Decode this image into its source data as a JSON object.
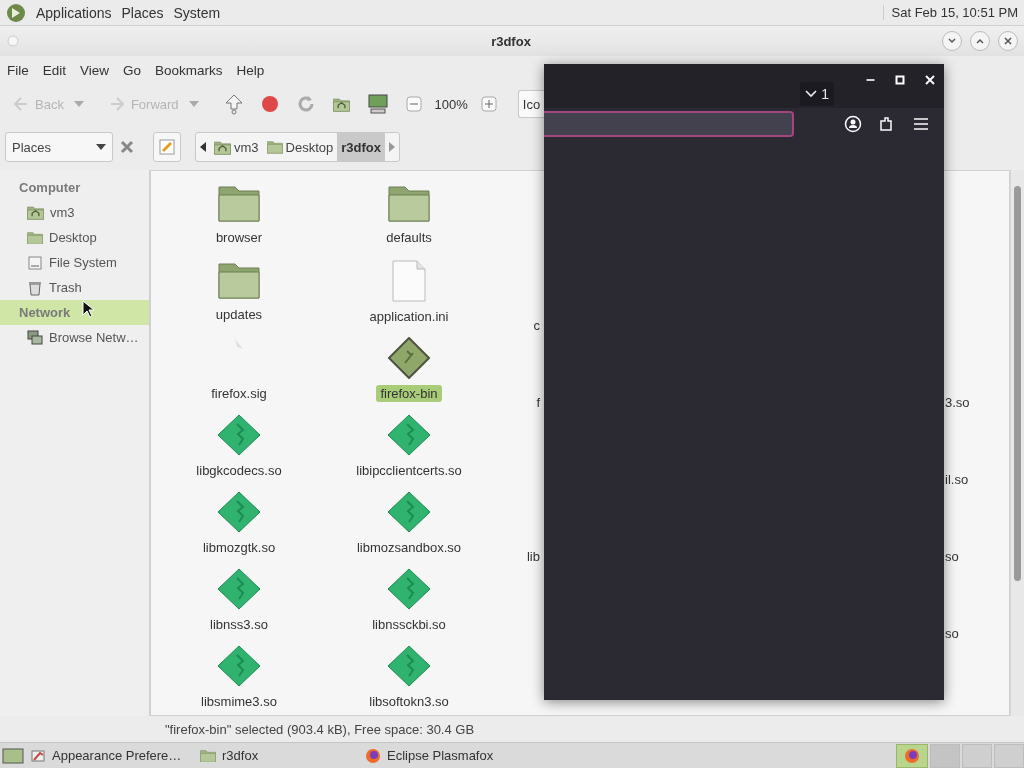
{
  "top_panel": {
    "menus": [
      "Applications",
      "Places",
      "System"
    ],
    "clock": "Sat Feb 15, 10:51 PM"
  },
  "file_manager": {
    "title": "r3dfox",
    "menu": [
      "File",
      "Edit",
      "View",
      "Go",
      "Bookmarks",
      "Help"
    ],
    "toolbar": {
      "back": {
        "label": "Back",
        "disabled": true
      },
      "forward": {
        "label": "Forward",
        "disabled": true
      },
      "zoom": "100%",
      "view_select": "Ico"
    },
    "location": {
      "places_select": "Places",
      "breadcrumb": [
        {
          "label": "vm3",
          "selected": false
        },
        {
          "label": "Desktop",
          "selected": false
        },
        {
          "label": "r3dfox",
          "selected": true
        }
      ]
    },
    "sidebar": [
      {
        "heading": "Computer",
        "highlighted": false,
        "items": [
          "vm3",
          "Desktop",
          "File System",
          "Trash"
        ]
      },
      {
        "heading": "Network",
        "highlighted": true,
        "items": [
          "Browse Netw…"
        ]
      }
    ],
    "rows": [
      [
        {
          "kind": "folder",
          "name": "browser",
          "selected": false
        },
        {
          "kind": "folder",
          "name": "defaults",
          "selected": false
        },
        {
          "kind": "hidden"
        },
        {
          "kind": "hidden"
        },
        {
          "kind": "hidden"
        }
      ],
      [
        {
          "kind": "folder",
          "name": "updates",
          "selected": false
        },
        {
          "kind": "document",
          "name": "application.ini",
          "selected": false
        },
        {
          "kind": "clipped_left",
          "name": "c"
        },
        {
          "kind": "hidden"
        },
        {
          "kind": "hidden"
        }
      ],
      [
        {
          "kind": "sig",
          "name": "firefox.sig",
          "selected": false
        },
        {
          "kind": "executable",
          "name": "firefox-bin",
          "selected": true
        },
        {
          "kind": "clipped_left",
          "name": "f"
        },
        {
          "kind": "hidden"
        },
        {
          "kind": "clipped_right",
          "name": "3.so"
        }
      ],
      [
        {
          "kind": "library",
          "name": "libgkcodecs.so",
          "selected": false
        },
        {
          "kind": "library",
          "name": "libipcclientcerts.so",
          "selected": false
        },
        {
          "kind": "hidden"
        },
        {
          "kind": "hidden"
        },
        {
          "kind": "clipped_right",
          "name": "il.so"
        }
      ],
      [
        {
          "kind": "library",
          "name": "libmozgtk.so",
          "selected": false
        },
        {
          "kind": "library",
          "name": "libmozsandbox.so",
          "selected": false
        },
        {
          "kind": "clipped_left",
          "name": "lib"
        },
        {
          "kind": "hidden"
        },
        {
          "kind": "clipped_right",
          "name": "so"
        }
      ],
      [
        {
          "kind": "library",
          "name": "libnss3.so",
          "selected": false
        },
        {
          "kind": "library",
          "name": "libnssckbi.so",
          "selected": false
        },
        {
          "kind": "hidden"
        },
        {
          "kind": "hidden"
        },
        {
          "kind": "clipped_right",
          "name": "so"
        }
      ],
      [
        {
          "kind": "library",
          "name": "libsmime3.so",
          "selected": false
        },
        {
          "kind": "library",
          "name": "libsoftokn3.so",
          "selected": false
        },
        {
          "kind": "hidden"
        },
        {
          "kind": "hidden"
        },
        {
          "kind": "hidden"
        }
      ]
    ],
    "status": "\"firefox-bin\" selected (903.4 kB), Free space: 30.4 GB"
  },
  "browser_window": {
    "tab_count": "1"
  },
  "taskbar": {
    "tasks": [
      "Appearance Prefere…",
      "r3dfox",
      "Eclipse Plasmafox"
    ]
  }
}
